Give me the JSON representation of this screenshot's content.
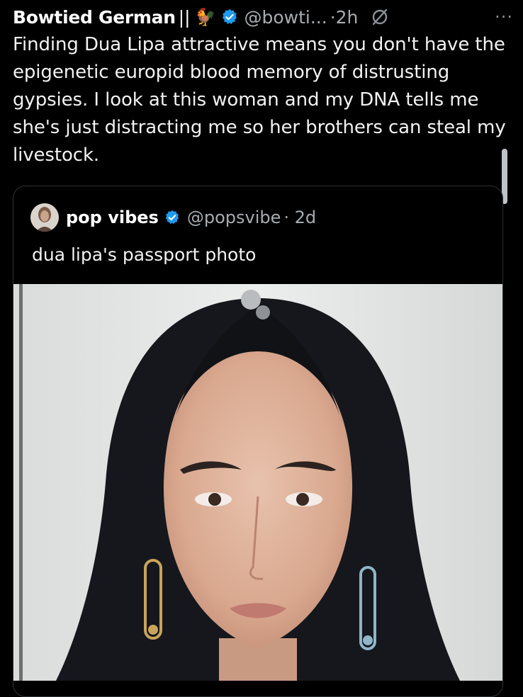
{
  "tweet": {
    "author_name": "Bowtied German",
    "name_suffix": "||",
    "emoji": "🐓",
    "handle": "@bowti...",
    "time": "·2h",
    "more": "···",
    "text": "Finding Dua Lipa attractive means you don't have the epigenetic europid blood memory of distrusting gypsies.  I look at this woman and my DNA tells me she's just distracting me so her brothers can steal my livestock."
  },
  "quote": {
    "author_name": "pop vibes",
    "handle": "@popsvibe",
    "time": "· 2d",
    "text": "dua lipa's passport photo"
  },
  "colors": {
    "background": "#000000",
    "verified": "#1d9bf0",
    "muted_text": "#a7acb1",
    "border": "#2f3336"
  }
}
